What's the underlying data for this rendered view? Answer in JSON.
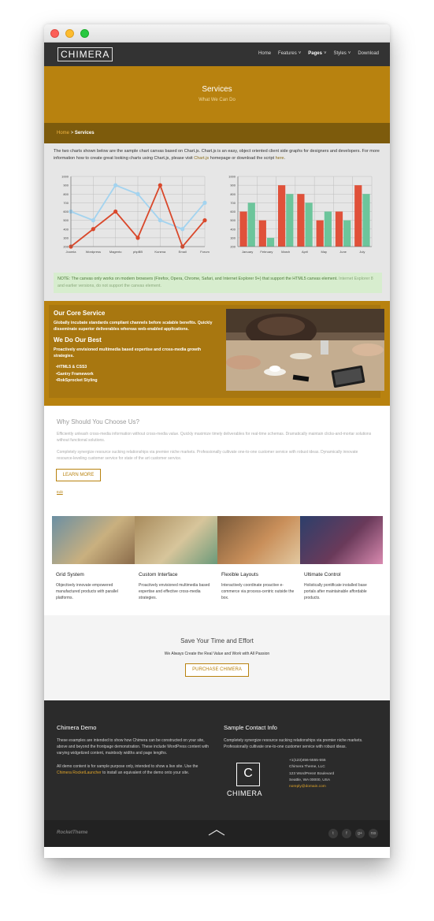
{
  "window": {
    "controls": [
      "close",
      "minimize",
      "maximize"
    ]
  },
  "header": {
    "logo": "CHIMERA",
    "nav": [
      {
        "label": "Home",
        "dropdown": false,
        "active": false
      },
      {
        "label": "Features",
        "dropdown": true,
        "active": false
      },
      {
        "label": "Pages",
        "dropdown": true,
        "active": true
      },
      {
        "label": "Styles",
        "dropdown": true,
        "active": false
      },
      {
        "label": "Download",
        "dropdown": false,
        "active": false
      }
    ]
  },
  "hero": {
    "title": "Services",
    "subtitle": "What We Can Do"
  },
  "breadcrumb": {
    "home": "Home",
    "separator": ">",
    "current": "Services"
  },
  "charts": {
    "intro": "The two charts shown below are the sample chart canvas based on Chart.js. Chart.js is an easy, object oriented client side graphs for designers and developers. For more information how to create great looking charts using Chart.js, please visit ",
    "intro_link": "Chart.js",
    "intro_mid": " homepage or download the script ",
    "intro_link2": "here",
    "intro_end": ".",
    "note": "NOTE: The canvas only works on modern browsers (Firefox, Opera, Chrome, Safari, and Internet Explorer 9+) that support the HTML5 canvas element. ",
    "note_link": "Internet Explorer 8 and earlier versions, do not support the canvas element."
  },
  "chart_data": [
    {
      "type": "line",
      "categories": [
        "Joomla",
        "Wordpress",
        "Magento",
        "phpBB",
        "Kunena",
        "Email",
        "Forum"
      ],
      "series": [
        {
          "color": "#a3d3ef",
          "values": [
            600,
            500,
            900,
            800,
            500,
            400,
            700
          ]
        },
        {
          "color": "#d9482b",
          "values": [
            200,
            400,
            600,
            300,
            900,
            200,
            500
          ]
        }
      ],
      "yticks": [
        200,
        300,
        400,
        500,
        600,
        700,
        800,
        900,
        1000
      ],
      "ylim": [
        200,
        1000
      ],
      "grid": true
    },
    {
      "type": "bar",
      "categories": [
        "January",
        "February",
        "March",
        "April",
        "May",
        "June",
        "July"
      ],
      "series": [
        {
          "color": "#e0513a",
          "values": [
            600,
            500,
            900,
            800,
            500,
            600,
            900
          ]
        },
        {
          "color": "#6cc59b",
          "values": [
            700,
            300,
            800,
            700,
            600,
            500,
            800
          ]
        }
      ],
      "yticks": [
        200,
        300,
        400,
        500,
        600,
        700,
        800,
        900,
        1000
      ],
      "ylim": [
        200,
        1000
      ],
      "grid": true
    }
  ],
  "core": {
    "title1": "Our Core Service",
    "text1": "Globally incubate standards compliant channels before scalable benefits. Quickly disseminate superior deliverables whereas web-enabled applications.",
    "title2": "We Do Our Best",
    "text2": "Proactively envisioned multimedia based expertise and cross-media growth strategies.",
    "list": [
      "HTML5 & CSS3",
      "Gantry Framework",
      "RokSprocket Styling"
    ]
  },
  "why": {
    "title": "Why Should You Choose Us?",
    "p1": "Efficiently unleash cross-media information without cross-media value. Quickly maximize timely deliverables for real-time schemas. Dramatically maintain clicks-and-mortar solutions without functional solutions.",
    "p2": "Completely synergize resource sucking relationships via premier niche markets. Professionally cultivate one-to-one customer service with robust ideas. Dynamically innovate resource-leveling customer service for state of the art customer service.",
    "button": "LEARN MORE",
    "edit": "Edit"
  },
  "features": [
    {
      "title": "Grid System",
      "text": "Objectively innovate empowered manufactured products with parallel platforms."
    },
    {
      "title": "Custom Interface",
      "text": "Proactively envisioned multimedia based expertise and effective cross-media strategies."
    },
    {
      "title": "Flexible Layouts",
      "text": "Interactively coordinate proactive e-commerce via process-centric outside the box."
    },
    {
      "title": "Ultimate Control",
      "text": "Holistically pontificate installed base portals after maintainable affordable products."
    }
  ],
  "cta": {
    "title": "Save Your Time and Effort",
    "subtitle": "We Always Create the Real Value and Work with All Passion",
    "button": "PURCHASE CHIMERA"
  },
  "footer": {
    "demo_title": "Chimera Demo",
    "demo_p1": "These examples are intended to show how Chimera can be constructed on your site, above and beyond the frontpage demonstration. These include WordPress content with varying widgetized content, mainbody widths and page lengths.",
    "demo_p2a": "All demo content is for sample purpose only, intended to show a live site. Use the ",
    "demo_p2_link": "Chimera RocketLauncher",
    "demo_p2b": " to install an equivalent of the demo onto your site.",
    "contact_title": "Sample Contact Info",
    "contact_p": "Completely synergize resource sucking relationships via premier niche markets. Professionally cultivate one-to-one customer service with robust ideas.",
    "logo_letter": "C",
    "logo_text": "CHIMERA",
    "address": [
      "+1(123)456-5555-555",
      "Chimera Theme, LLC",
      "123 WordPress! Boulevard",
      "Seattle, WA 00000, USA"
    ],
    "email": "noreply@domain.com"
  },
  "bottom": {
    "brand": "RocketTheme",
    "social": [
      "t",
      "f",
      "g+",
      "rss"
    ]
  }
}
